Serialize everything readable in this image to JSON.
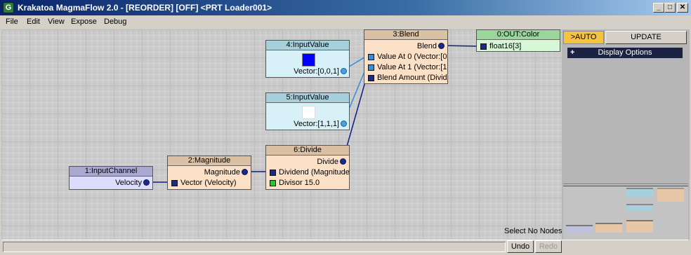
{
  "window": {
    "title": "Krakatoa MagmaFlow 2.0 - [REORDER] [OFF] <PRT Loader001>",
    "app_icon": "G",
    "minimize_glyph": "_",
    "maximize_glyph": "□",
    "close_glyph": "✕"
  },
  "menu": [
    "File",
    "Edit",
    "View",
    "Expose",
    "Debug"
  ],
  "nodes": {
    "input_value_4": {
      "title": "4:InputValue",
      "output": "Vector:[0,0,1]",
      "swatch_color": "#0000ff"
    },
    "input_value_5": {
      "title": "5:InputValue",
      "output": "Vector:[1,1,1]",
      "swatch_color": "#ffffff"
    },
    "blend_3": {
      "title": "3:Blend",
      "output": "Blend",
      "inputs": [
        "Value At 0 (Vector:[0",
        "Value At 1 (Vector:[1",
        "Blend Amount (Divide"
      ]
    },
    "out_color_0": {
      "title": "0:OUT:Color",
      "input": "float16[3]"
    },
    "input_channel_1": {
      "title": "1:InputChannel",
      "output": "Velocity"
    },
    "magnitude_2": {
      "title": "2:Magnitude",
      "output": "Magnitude",
      "input": "Vector (Velocity)"
    },
    "divide_6": {
      "title": "6:Divide",
      "output": "Divide",
      "inputs": [
        "Dividend (Magnitude)",
        "Divisor 15.0"
      ]
    }
  },
  "colors": {
    "node_body": "#fde1c6",
    "node_header": "#dcc0a4",
    "input_node_body": "#d8f0f8",
    "input_node_header": "#a6d0dc",
    "channel_node_body": "#dcdcff",
    "channel_node_header": "#a8a8d0",
    "output_node_body": "#d6f8d6",
    "output_node_header": "#9ad69a",
    "wire_dark": "#0b1a8a",
    "wire_light": "#2f8ee0"
  },
  "right_panel": {
    "auto_label": ">AUTO",
    "update_label": "UPDATE",
    "display_options_label": "Display Options",
    "display_options_toggle": "+"
  },
  "status": {
    "selection_text": "Select No Nodes",
    "undo_label": "Undo",
    "redo_label": "Redo"
  }
}
